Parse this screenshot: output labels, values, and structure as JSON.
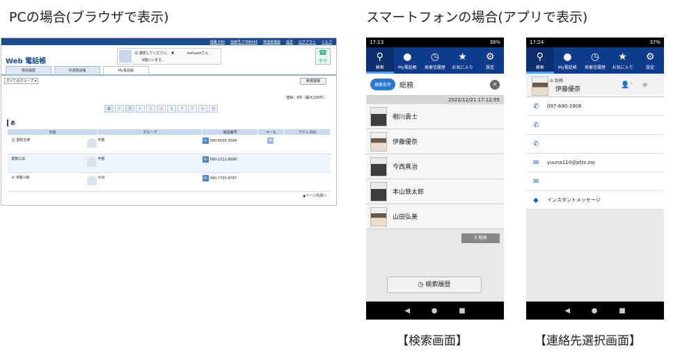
{
  "headings": {
    "pc": "PCの場合(ブラウザで表示)",
    "app": "スマートフォンの場合(アプリで表示)"
  },
  "pc": {
    "top_links": [
      "部署:090",
      "自席号:7788444",
      "管理者機能",
      "設定",
      "ログアウト",
      "ヘルプ"
    ],
    "logo": "Web 電話帳",
    "user_select": "選択してください。",
    "user_note": "6階にいます。",
    "user_name": "testuserさん",
    "call_label": "発 信",
    "tabs": [
      "発信履歴",
      "共通電話帳",
      "My電話帳"
    ],
    "filter": "すべてのグループ",
    "new_button": "新規登録",
    "count": "登録：9件（最大100件）",
    "kana": [
      "あ",
      "か",
      "さ",
      "た",
      "な",
      "は",
      "ま",
      "や",
      "ら",
      "わ",
      "他"
    ],
    "section": "あ",
    "columns": [
      "氏名",
      "グループ",
      "電話番号",
      "メール",
      "アドレスID"
    ],
    "rows": [
      {
        "name": "愛知五郎",
        "group": "中部",
        "phone": "090-5555-3399"
      },
      {
        "name": "愛知三夫",
        "group": "中部",
        "phone": "090-2211-9999"
      },
      {
        "name": "沖縄三郎",
        "group": "九州",
        "phone": "090-7755-8787"
      }
    ],
    "page_top": "▲ページ先頭へ"
  },
  "phone1": {
    "time": "17:13",
    "battery": "38%",
    "tabs": [
      "検索",
      "My電話帳",
      "発着信履歴",
      "お気に入り",
      "設定"
    ],
    "chip": "検索条件",
    "query": "総務",
    "datetime": "2022/12/21 17:12:55",
    "contacts": [
      "相川貴士",
      "伊藤優奈",
      "今西真治",
      "本山鉄太郎",
      "山田弘美"
    ],
    "tag": "総務",
    "history_button": "検索履歴",
    "caption": "【検索画面】"
  },
  "phone2": {
    "time": "17:24",
    "battery": "37%",
    "tabs": [
      "検索",
      "My電話帳",
      "発着信履歴",
      "お気に入り",
      "設定"
    ],
    "dept": "総務",
    "name": "伊藤優奈",
    "phone1": "097-690-2806",
    "email": "yuuna110@pfzz.zoj",
    "im": "インスタントメッセージ",
    "caption": "【連絡先選択画面】"
  }
}
